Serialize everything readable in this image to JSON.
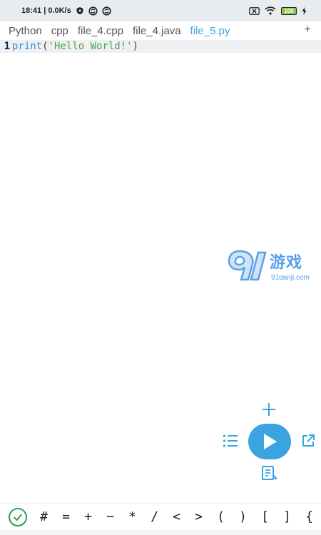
{
  "status_bar": {
    "time_speed": "18:41 | 0.0K/s",
    "battery": "100",
    "icons": [
      "shield-icon",
      "sync-icon",
      "sync-icon",
      "sim-x-icon",
      "wifi-icon",
      "battery-icon",
      "charging-bolt-icon"
    ]
  },
  "tabs": {
    "items": [
      {
        "label": "Python",
        "active": false
      },
      {
        "label": "cpp",
        "active": false
      },
      {
        "label": "file_4.cpp",
        "active": false
      },
      {
        "label": "file_4.java",
        "active": false
      },
      {
        "label": "file_5.py",
        "active": true
      }
    ],
    "add_label": "+"
  },
  "editor": {
    "line_number": "1",
    "code": {
      "keyword": "print",
      "open": "(",
      "string": "'Hello World!'",
      "close": ")"
    }
  },
  "watermark": {
    "logo": "91",
    "text": "游戏",
    "url": "91danji.com"
  },
  "symbols": [
    "#",
    "=",
    "+",
    "−",
    "*",
    "/",
    "<",
    ">",
    "(",
    ")",
    "[",
    "]",
    "{"
  ],
  "colors": {
    "accent": "#3ba4e0",
    "string": "#4aa54a",
    "check": "#2e9e4f"
  }
}
